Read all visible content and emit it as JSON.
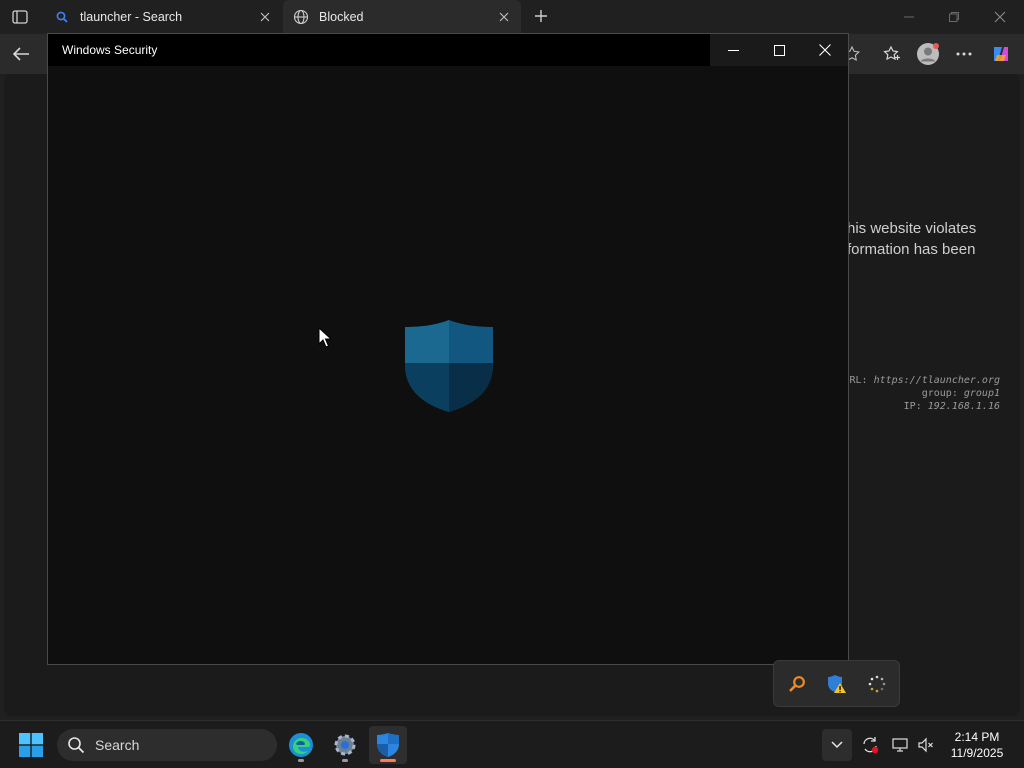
{
  "browser": {
    "tabs": [
      {
        "label": "tlauncher - Search",
        "icon": "search-icon"
      },
      {
        "label": "Blocked",
        "icon": "globe-icon"
      }
    ]
  },
  "page": {
    "warning_lines": [
      "his website violates",
      "formation has been"
    ],
    "meta": {
      "url_label": "RL:",
      "url_value": "https://tlauncher.org",
      "group_label": "group:",
      "group_value": "group1",
      "ip_label": "IP:",
      "ip_value": "192.168.1.16"
    }
  },
  "dialog": {
    "title": "Windows Security",
    "shield_color": "#1a6fa0"
  },
  "taskbar": {
    "search_label": "Search",
    "time": "2:14 PM",
    "date": "11/9/2025"
  },
  "colors": {
    "accent": "#0078d4",
    "active_indicator": "#ff7a5a"
  }
}
